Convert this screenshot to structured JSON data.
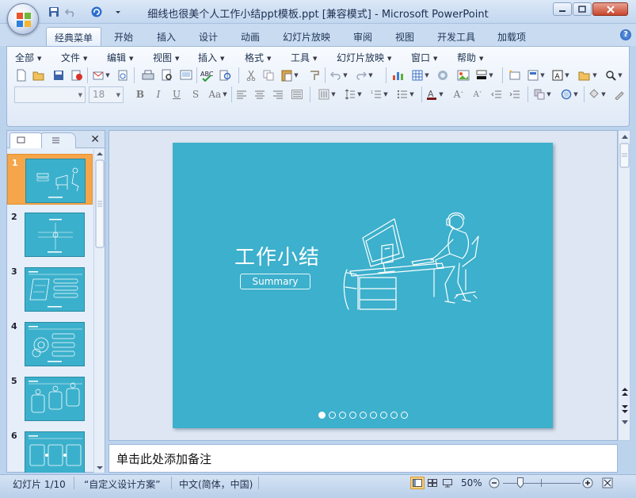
{
  "window": {
    "title": "细线也很美个人工作小结ppt模板.ppt [兼容模式] - Microsoft PowerPoint"
  },
  "ribbon_tabs": [
    {
      "label": "经典菜单",
      "active": true
    },
    {
      "label": "开始"
    },
    {
      "label": "插入"
    },
    {
      "label": "设计"
    },
    {
      "label": "动画"
    },
    {
      "label": "幻灯片放映"
    },
    {
      "label": "审阅"
    },
    {
      "label": "视图"
    },
    {
      "label": "开发工具"
    },
    {
      "label": "加载项"
    }
  ],
  "classic_menu": [
    "全部",
    "文件",
    "编辑",
    "视图",
    "插入",
    "格式",
    "工具",
    "幻灯片放映",
    "窗口",
    "帮助"
  ],
  "format_toolbar": {
    "font_name": "",
    "font_size": "18"
  },
  "slides": [
    {
      "number": "1",
      "selected": true
    },
    {
      "number": "2"
    },
    {
      "number": "3"
    },
    {
      "number": "4"
    },
    {
      "number": "5"
    },
    {
      "number": "6"
    }
  ],
  "slide": {
    "title": "工作小结",
    "subtitle": "Summary",
    "background_color": "#3cb0cc",
    "dots_total": 9,
    "dot_active": 1
  },
  "notes": {
    "placeholder": "单击此处添加备注"
  },
  "status": {
    "slide_indicator": "幻灯片 1/10",
    "theme": "“自定义设计方案”",
    "language": "中文(简体，中国)",
    "zoom": "50%"
  },
  "colors": {
    "accent": "#f5a64a",
    "ribbon": "#dfe9f6"
  }
}
